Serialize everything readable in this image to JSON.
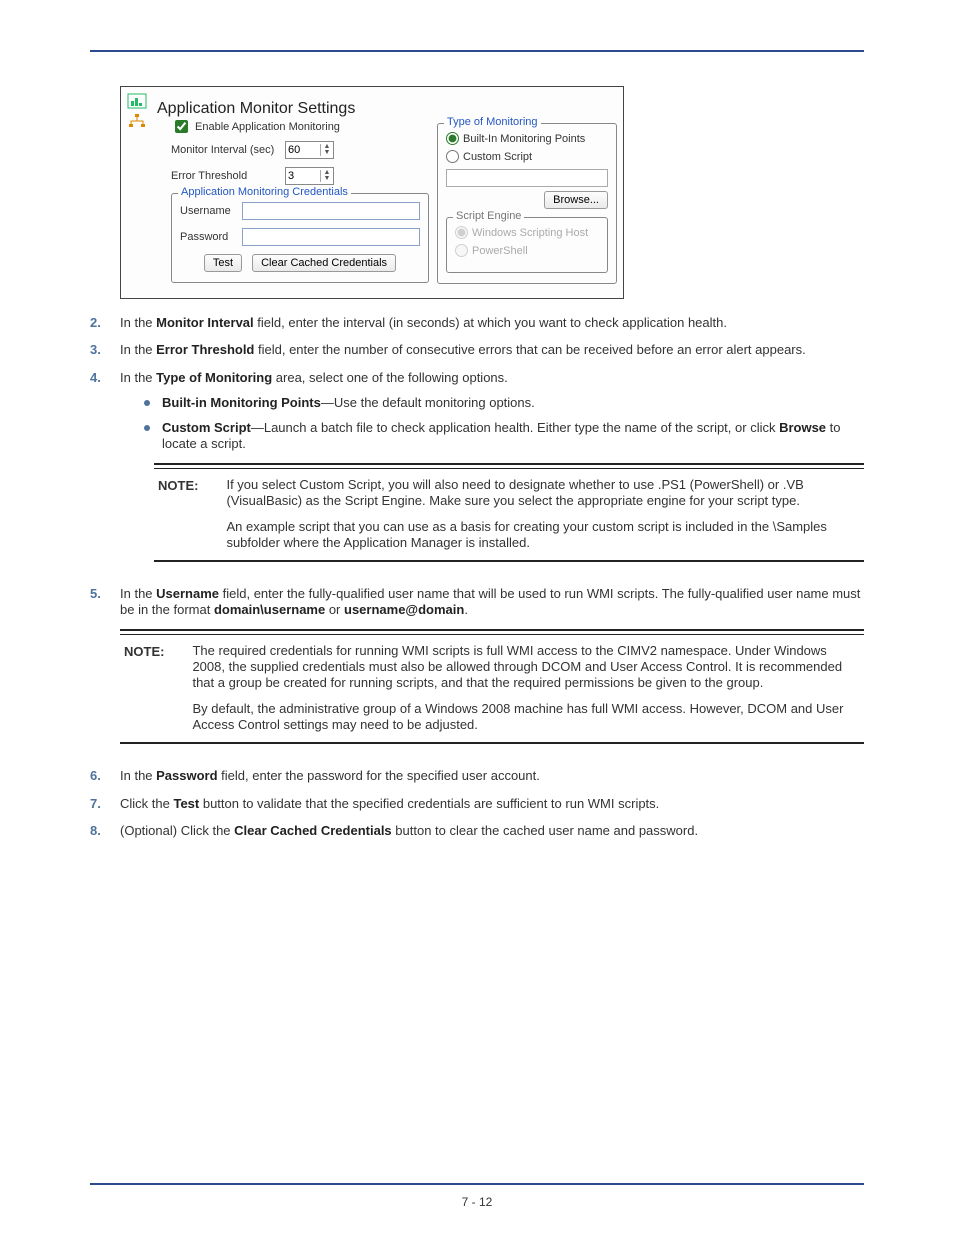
{
  "figure": {
    "title": "Application Monitor Settings",
    "enable_label": "Enable Application Monitoring",
    "monitor_interval_label": "Monitor Interval (sec)",
    "monitor_interval_value": "60",
    "error_threshold_label": "Error Threshold",
    "error_threshold_value": "3",
    "credentials_legend": "Application Monitoring Credentials",
    "username_label": "Username",
    "password_label": "Password",
    "test_btn": "Test",
    "clear_btn": "Clear Cached Credentials",
    "type_legend": "Type of Monitoring",
    "radio_builtin": "Built-In Monitoring Points",
    "radio_custom": "Custom Script",
    "browse_btn": "Browse...",
    "engine_legend": "Script Engine",
    "radio_wsh": "Windows Scripting Host",
    "radio_ps": "PowerShell"
  },
  "steps": {
    "s2": {
      "num": "2.",
      "text_a": "In the ",
      "b1": "Monitor Interval",
      "text_b": " field, enter the interval (in seconds) at which you want to check application health."
    },
    "s3": {
      "num": "3.",
      "text_a": "In the ",
      "b1": "Error Threshold",
      "text_b": " field, enter the number of consecutive errors that can be received before an error alert appears."
    },
    "s4": {
      "num": "4.",
      "text_a": "In the ",
      "b1": "Type of Monitoring",
      "text_b": " area, select one of the following options."
    },
    "bullet1": {
      "b1": "Built-in Monitoring Points",
      "text": "—Use the default monitoring options."
    },
    "bullet2": {
      "b1": "Custom Script",
      "text_a": "—Launch a batch file to check application health. Either type the name of the script, or click ",
      "b2": "Browse",
      "text_b": " to locate a script."
    },
    "note1_label": "NOTE:",
    "note1_p1": "If you select Custom Script, you will also need to designate whether to use .PS1 (PowerShell) or .VB (VisualBasic) as the Script Engine. Make sure you select the appropriate engine for your script type.",
    "note1_p2": "An example script that you can use as a basis for creating your custom script is included in the \\Samples subfolder where the Application Manager is installed.",
    "s5": {
      "num": "5.",
      "text_a": "In the ",
      "b1": "Username",
      "text_b": " field, enter the fully-qualified user name that will be used to run WMI scripts. The fully-qualified user name must be in the format ",
      "b2": "domain\\username",
      "text_c": " or ",
      "b3": "username@domain",
      "text_d": "."
    },
    "note2_label": "NOTE:",
    "note2_p1": "The required credentials for running WMI scripts is full WMI access to the CIMV2 namespace. Under Windows 2008, the supplied credentials must also be allowed through DCOM and User Access Control. It is recommended that a group be created for running scripts, and that the required permissions be given to the group.",
    "note2_p2": "By default, the administrative group of a Windows 2008 machine has full WMI access. However, DCOM and User Access Control settings may need to be adjusted.",
    "s6": {
      "num": "6.",
      "text_a": "In the ",
      "b1": "Password",
      "text_b": " field, enter the password for the specified user account."
    },
    "s7": {
      "num": "7.",
      "text_a": "Click the ",
      "b1": "Test",
      "text_b": " button to validate that the specified credentials are sufficient to run WMI scripts."
    },
    "s8": {
      "num": "8.",
      "text_a": "(Optional) Click the ",
      "b1": "Clear Cached Credentials",
      "text_b": " button to clear the cached user name and password."
    }
  },
  "footer": {
    "page": "7 - 12"
  }
}
